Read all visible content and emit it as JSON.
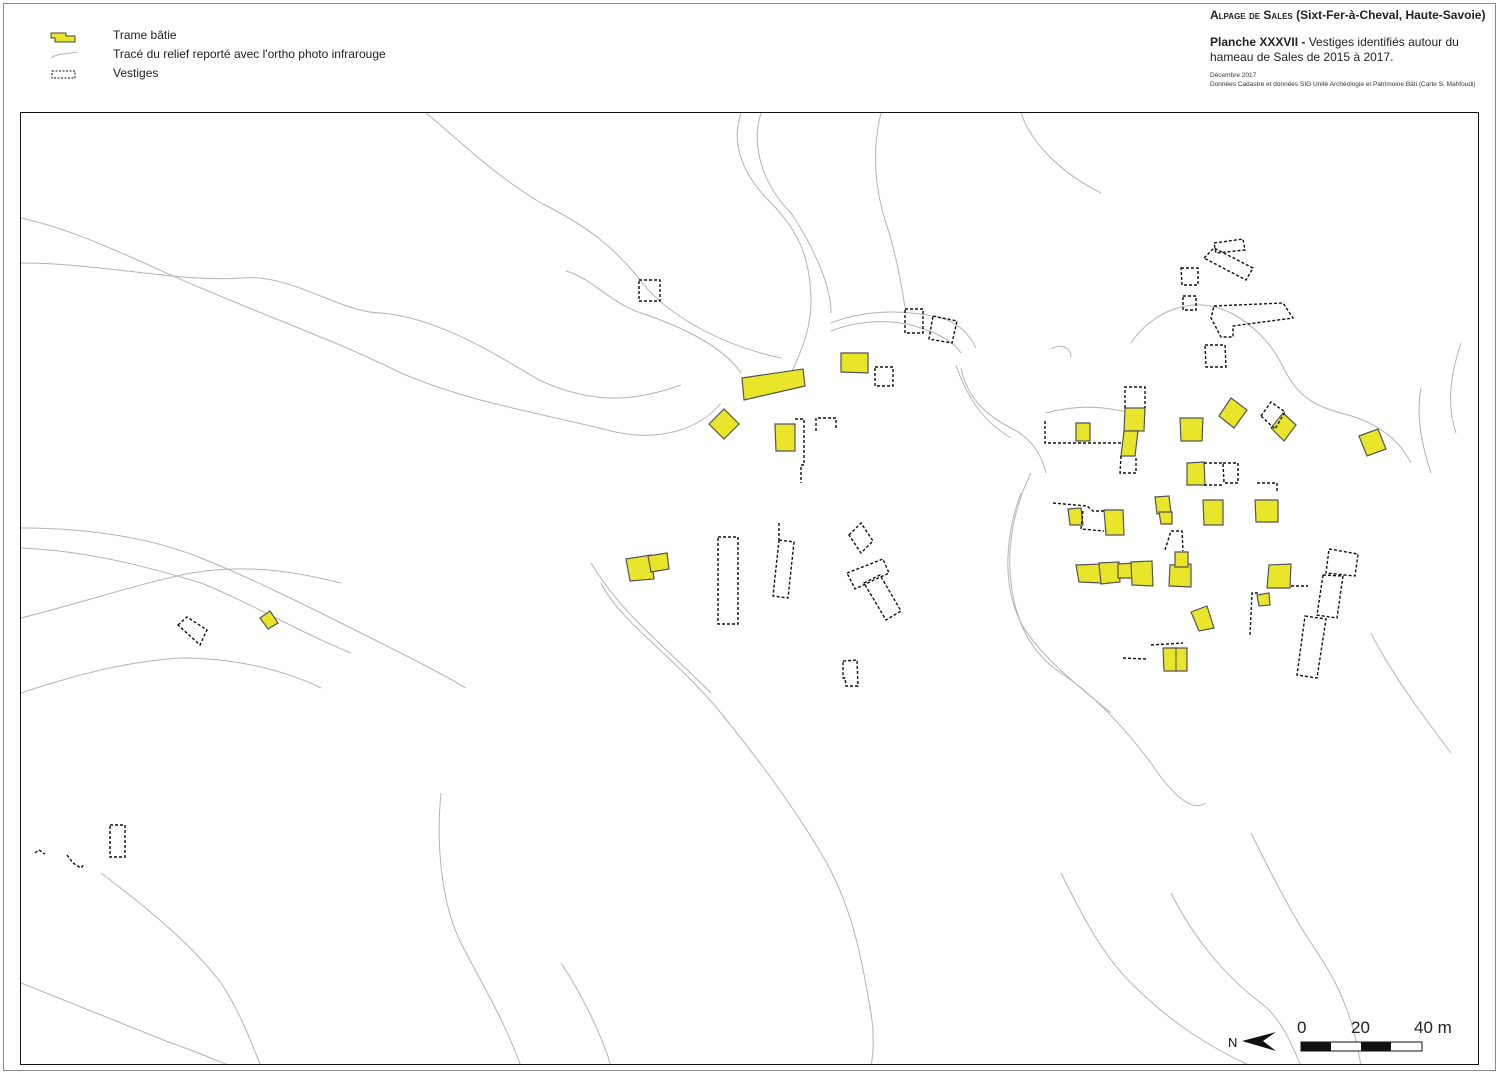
{
  "legend": {
    "items": [
      {
        "label": "Trame bâtie",
        "symbol": "yellow-filled-polygon"
      },
      {
        "label": "Tracé du relief reporté avec l'ortho photo infrarouge",
        "symbol": "grey-line"
      },
      {
        "label": "Vestiges",
        "symbol": "dashed-outline-polygon"
      }
    ]
  },
  "title": {
    "main_smallcaps": "Alpage de Sales",
    "main_rest": " (Sixt-Fer-à-Cheval, Haute-Savoie)",
    "planche_label": "Planche XXXVII - ",
    "planche_text": "Vestiges identifiés autour du hameau de Sales de 2015 à 2017.",
    "date": "Décembre 2017",
    "credits": "Données Cadastre et données SIG Unité Archéologie et Patrimoine Bâti (Carte S. Mahfoudi)"
  },
  "scale": {
    "labels": [
      "0",
      "20",
      "40 m"
    ],
    "north_letter": "N"
  },
  "colors": {
    "built_fill": "#e8e52b",
    "built_stroke": "#555555",
    "relief_line": "#b4b4b4",
    "vestige_stroke": "#111111"
  }
}
